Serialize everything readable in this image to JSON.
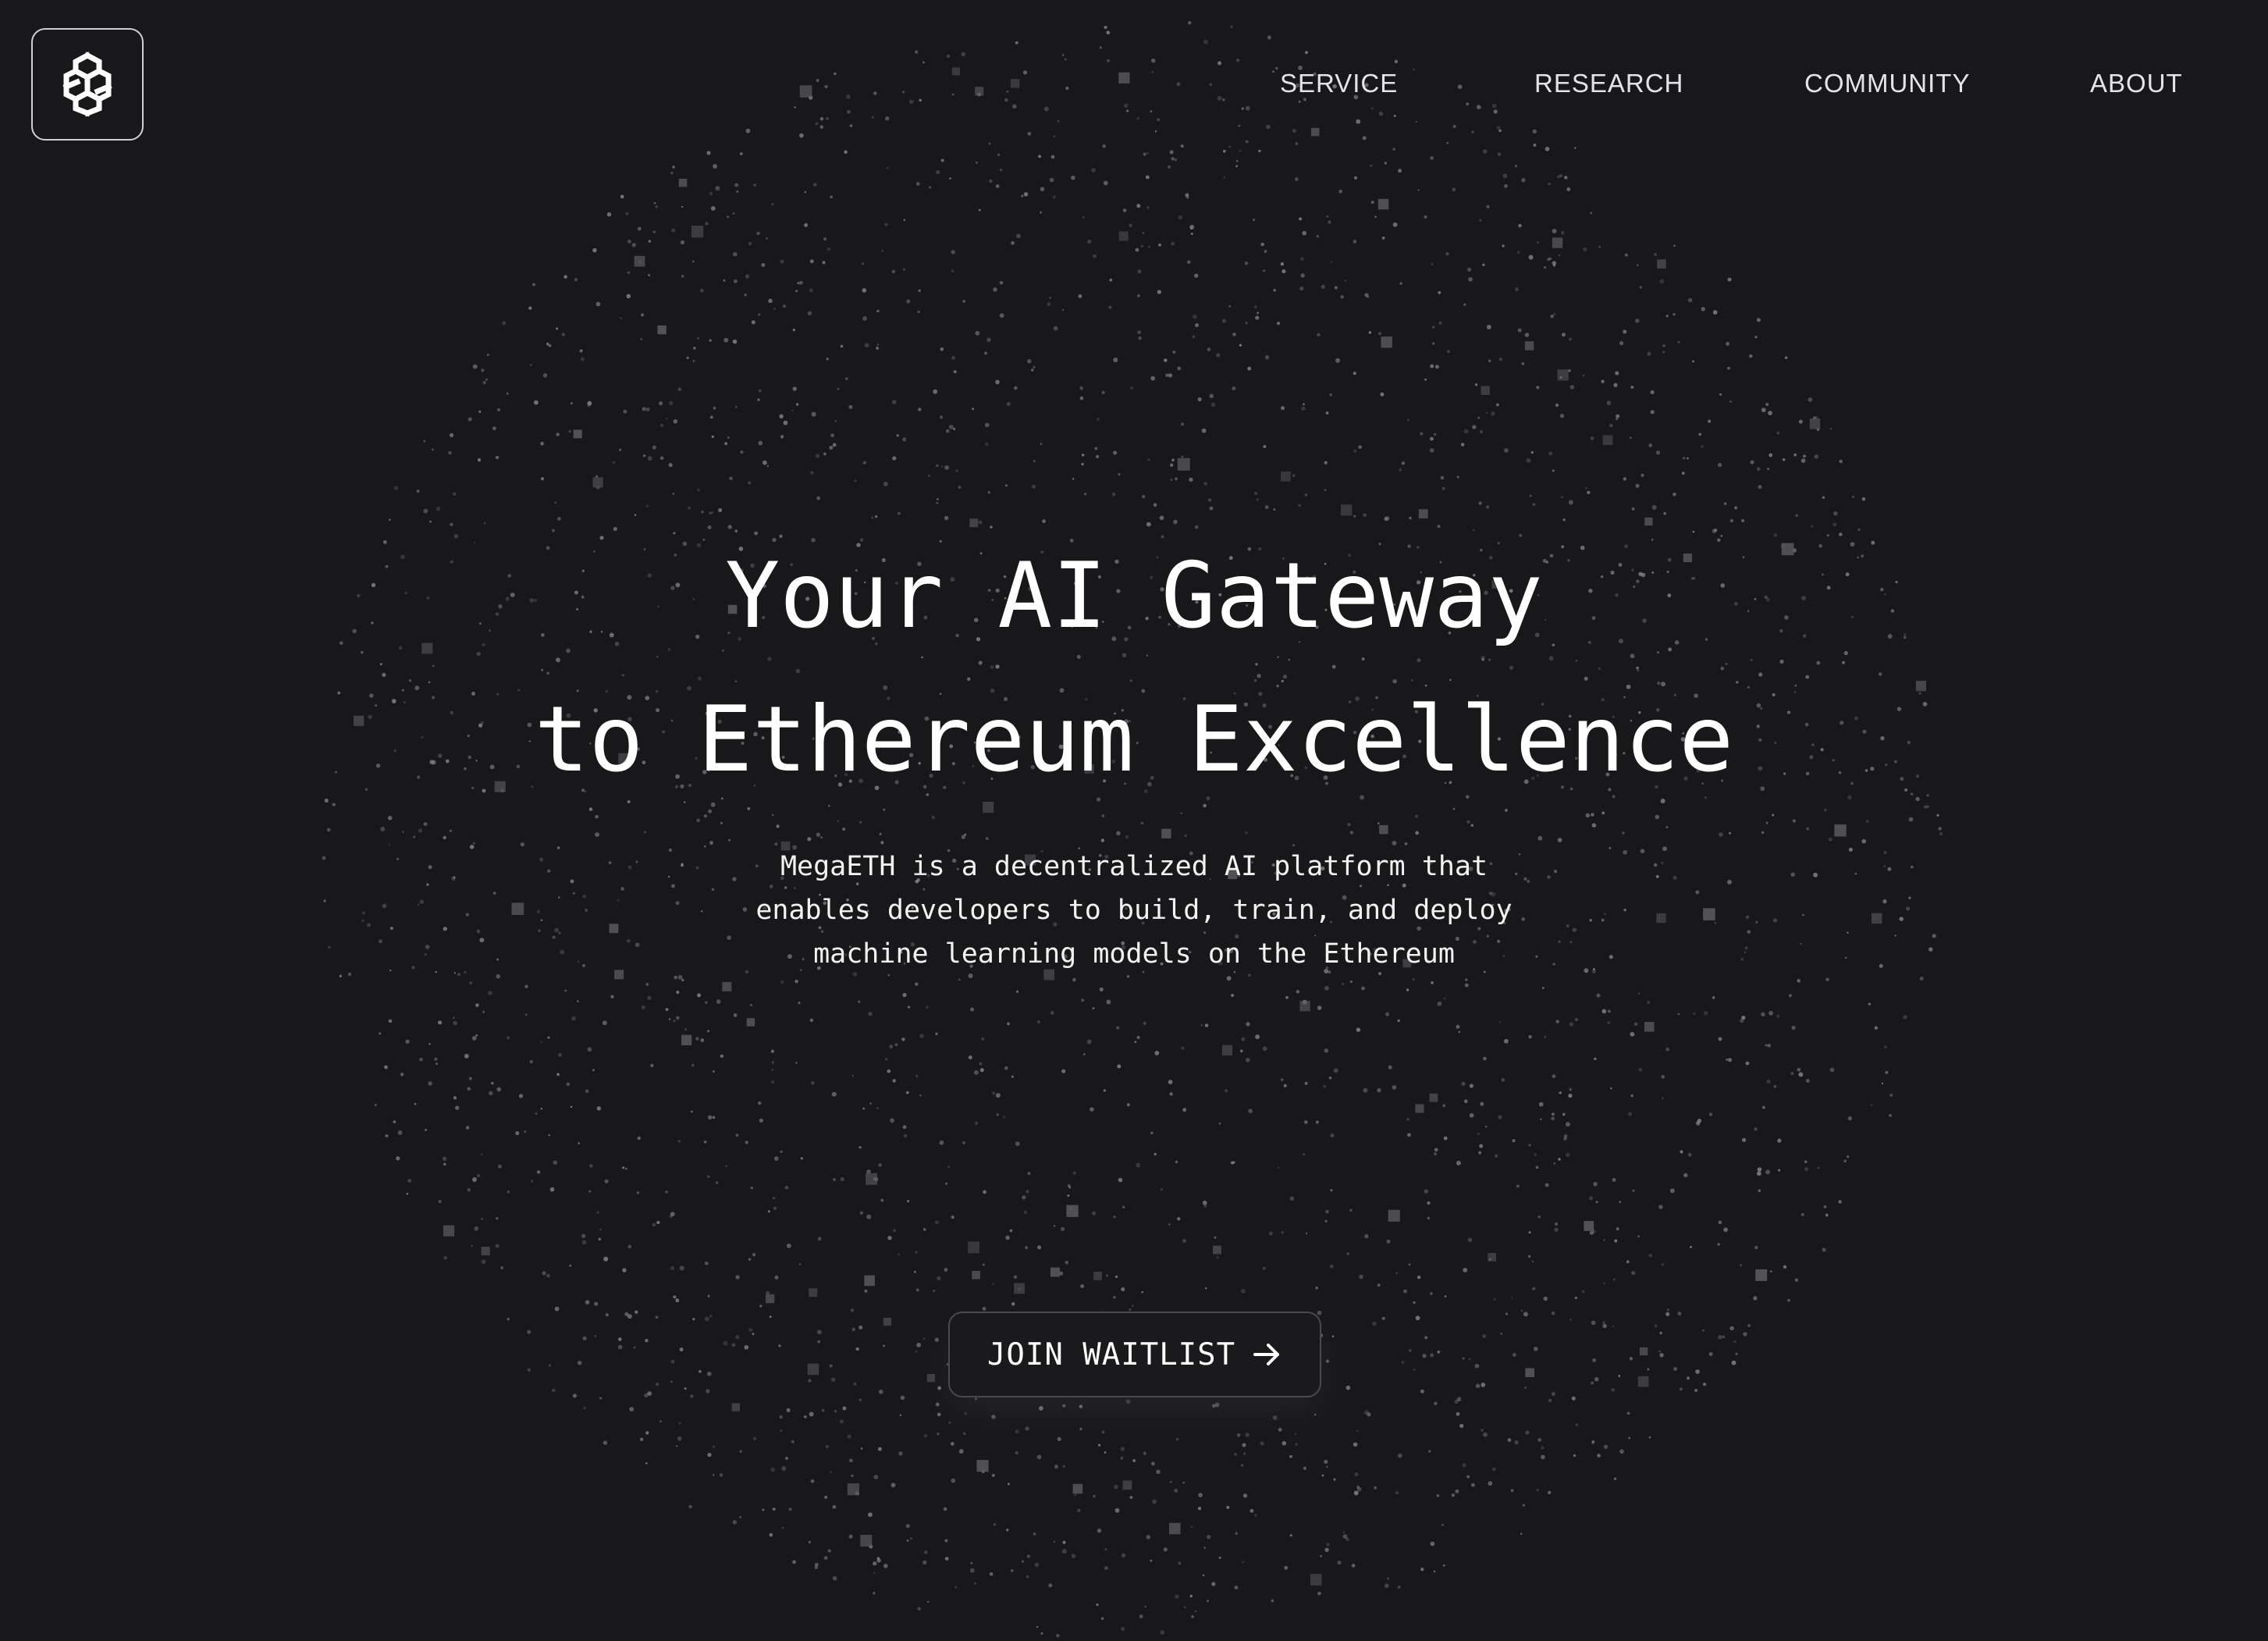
{
  "brand": {
    "logo_icon": "cube-knot-logo-icon"
  },
  "nav": {
    "items": [
      {
        "label": "SERVICE"
      },
      {
        "label": "RESEARCH"
      },
      {
        "label": "COMMUNITY"
      },
      {
        "label": "ABOUT"
      }
    ]
  },
  "hero": {
    "title_lines": [
      "Your AI Gateway",
      "to Ethereum Excellence"
    ],
    "description_lines": [
      "MegaETH is a decentralized AI platform that",
      "enables developers to build, train, and deploy",
      "machine learning models on the Ethereum"
    ],
    "cta": {
      "label": "JOIN WAITLIST",
      "icon": "arrow-right-icon"
    }
  },
  "colors": {
    "background": "#18181a",
    "text": "#ffffff",
    "particle": "#8a8a8e",
    "button_border": "#4a4a4e"
  }
}
